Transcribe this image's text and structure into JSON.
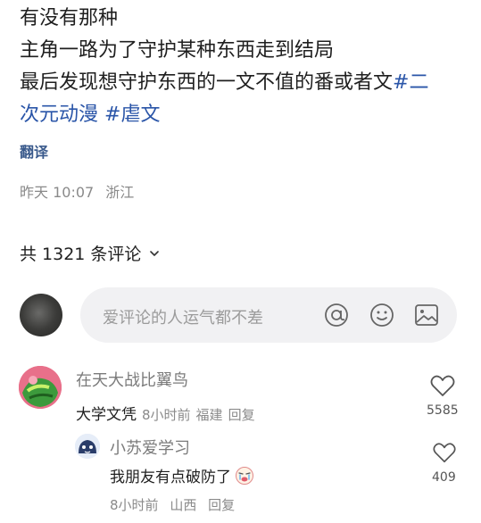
{
  "post": {
    "line1": "有没有那种",
    "line2": "主角一路为了守护某种东西走到结局",
    "line3_text": "最后发现想守护东西的一文不值的番或者文",
    "line3_tag": "#二",
    "line4_tag1": "次元动漫",
    "line4_tag2": "#虐文",
    "translate": "翻译",
    "time": "昨天 10:07",
    "location": "浙江"
  },
  "comments_header": {
    "count_label": "共 1321 条评论"
  },
  "composer": {
    "placeholder": "爱评论的人运气都不差",
    "icons": [
      "at-icon",
      "emoji-icon",
      "image-icon"
    ]
  },
  "comments": [
    {
      "author": "在天大战比翼鸟",
      "text": "大学文凭",
      "time": "8小时前",
      "location": "福建",
      "reply": "回复",
      "likes": "5585"
    },
    {
      "author": "小苏爱学习",
      "text": "我朋友有点破防了",
      "time": "8小时前",
      "location": "山西",
      "reply": "回复",
      "likes": "409"
    }
  ],
  "colors": {
    "hashtag": "#2a55a8",
    "muted": "#8a8a8a",
    "composer_bg": "#f1f1f3"
  }
}
